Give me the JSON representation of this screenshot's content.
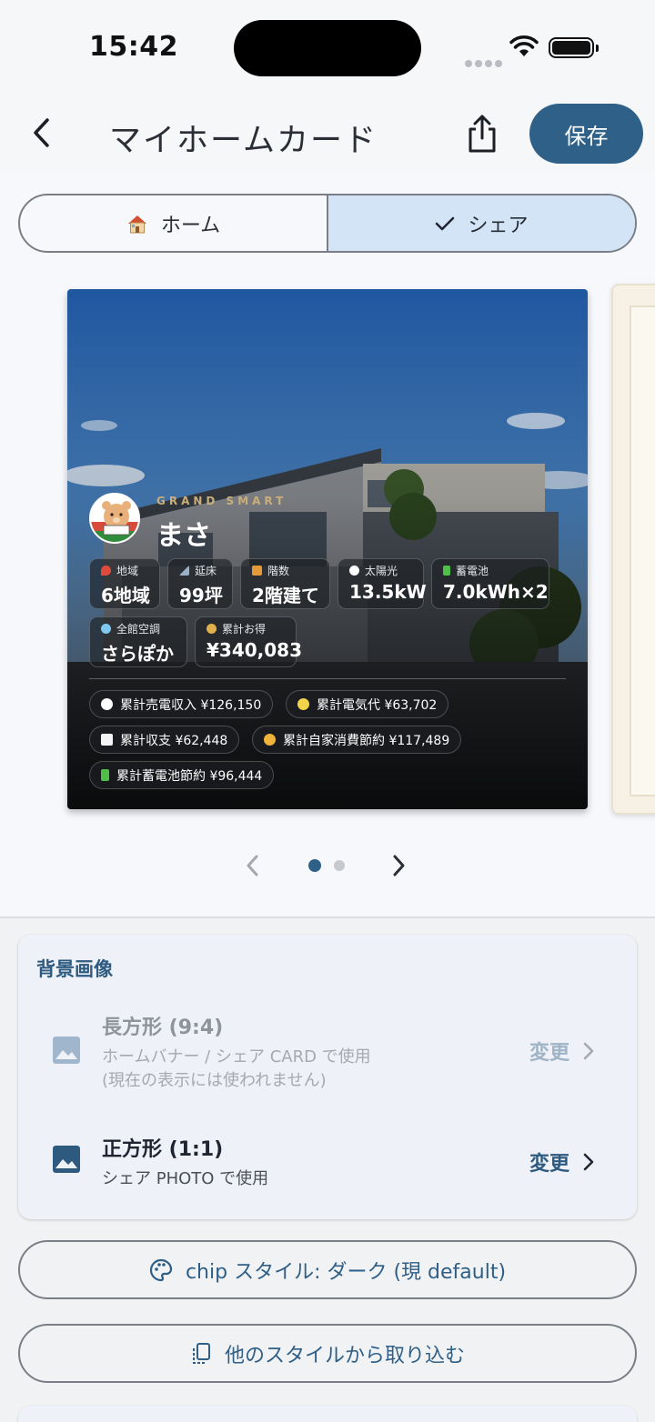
{
  "status_bar": {
    "time": "15:42"
  },
  "app_bar": {
    "title": "マイホームカード",
    "save_label": "保存"
  },
  "segments": [
    {
      "label": "ホーム",
      "icon": "house-emoji-icon",
      "selected": false
    },
    {
      "label": "シェア",
      "icon": "check-icon",
      "selected": true
    }
  ],
  "card": {
    "brand": "GRAND SMART",
    "user_name": "まさ",
    "stats": [
      {
        "label": "地域",
        "value": "6地域",
        "icon": "pin-icon"
      },
      {
        "label": "延床",
        "value": "99坪",
        "icon": "ruler-icon"
      },
      {
        "label": "階数",
        "value": "2階建て",
        "icon": "house-icon"
      },
      {
        "label": "太陽光",
        "value": "13.5kW",
        "icon": "sun-icon"
      },
      {
        "label": "蓄電池",
        "value": "7.0kWh×2",
        "icon": "battery-icon"
      },
      {
        "label": "全館空調",
        "value": "さらぽか",
        "icon": "snowflake-icon"
      },
      {
        "label": "累計お得",
        "value": "¥340,083",
        "icon": "money-bag-icon"
      }
    ],
    "pills": [
      {
        "text": "累計売電収入 ¥126,150",
        "icon": "sun-icon"
      },
      {
        "text": "累計電気代 ¥63,702",
        "icon": "bulb-icon"
      },
      {
        "text": "累計収支 ¥62,448",
        "icon": "chart-icon"
      },
      {
        "text": "累計自家消費節約 ¥117,489",
        "icon": "smile-icon"
      },
      {
        "text": "累計蓄電池節約 ¥96,444",
        "icon": "battery-icon"
      }
    ]
  },
  "pager": {
    "current_page": 1,
    "total_pages": 2
  },
  "background_image": {
    "heading": "背景画像",
    "items": [
      {
        "title": "長方形 (9:4)",
        "subtitle1": "ホームバナー / シェア CARD で使用",
        "subtitle2": "(現在の表示には使われません)",
        "action": "変更",
        "enabled": false
      },
      {
        "title": "正方形 (1:1)",
        "subtitle1": "シェア PHOTO で使用",
        "action": "変更",
        "enabled": true
      }
    ]
  },
  "buttons": {
    "chip_style": "chip スタイル: ダーク (現 default)",
    "import_style": "他のスタイルから取り込む"
  }
}
